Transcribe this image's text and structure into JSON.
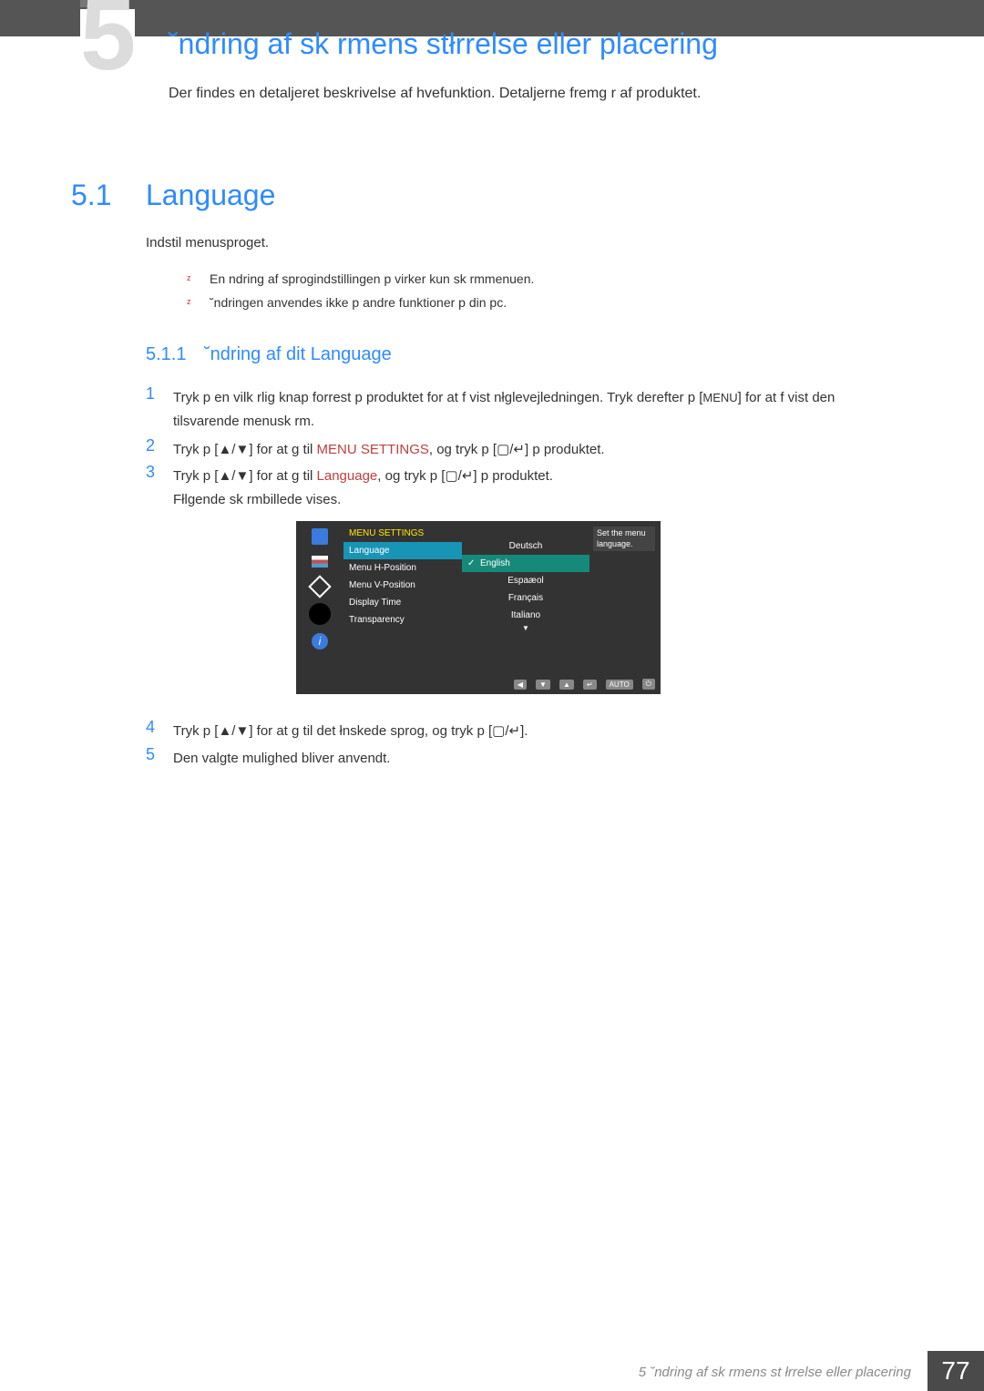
{
  "chapter_big": "5",
  "page_title": "˘ndring af sk rmens stłrrelse eller placering",
  "intro": "Der findes en detaljeret beskrivelse af hvefunktion. Detaljerne fremg r af produktet.",
  "section": {
    "num": "5.1",
    "title": "Language"
  },
  "body1": "Indstil menusproget.",
  "bullets": [
    "En  ndring af sprogindstillingen p virker kun sk rmmenuen.",
    "˘ndringen anvendes ikke p  andre funktioner p  din pc."
  ],
  "subsection": {
    "num": "5.1.1",
    "title": "˘ndring af dit Language"
  },
  "steps": {
    "s1_a": "Tryk p  en vilk rlig knap forrest p  produktet for at f  vist nłglevejledningen. Tryk derefter p  [",
    "s1_menu": "MENU",
    "s1_b": "] for at f  vist den tilsvarende menusk rm.",
    "s2_a": "Tryk p  [",
    "s2_arrows": "▲/▼",
    "s2_b": "] for at g  til ",
    "s2_hl": "MENU SETTINGS",
    "s2_c": ", og tryk p  [",
    "s2_icons": "▢/↵",
    "s2_d": "] p  produktet.",
    "s3_a": "Tryk p  [",
    "s3_arrows": "▲/▼",
    "s3_b": "] for at g  til ",
    "s3_hl": "Language",
    "s3_c": ", og tryk p  [",
    "s3_icons": "▢/↵",
    "s3_d": "] p  produktet.",
    "s3_e": "Fłlgende sk rmbillede vises.",
    "s4_a": "Tryk p  [",
    "s4_arrows": "▲/▼",
    "s4_b": "] for at g  til det łnskede sprog, og tryk p  [",
    "s4_icons": "▢/↵",
    "s4_c": "].",
    "s5": "Den valgte mulighed bliver anvendt."
  },
  "osd": {
    "title": "MENU SETTINGS",
    "items": [
      "Language",
      "Menu H-Position",
      "Menu V-Position",
      "Display Time",
      "Transparency"
    ],
    "languages": [
      "Deutsch",
      "English",
      "Espaæol",
      "Français",
      "Italiano"
    ],
    "hint": "Set the menu language.",
    "bot_auto": "AUTO"
  },
  "footer": {
    "text": "5 ˘ndring af sk rmens st    łrrelse eller placering",
    "page_num": "77"
  }
}
